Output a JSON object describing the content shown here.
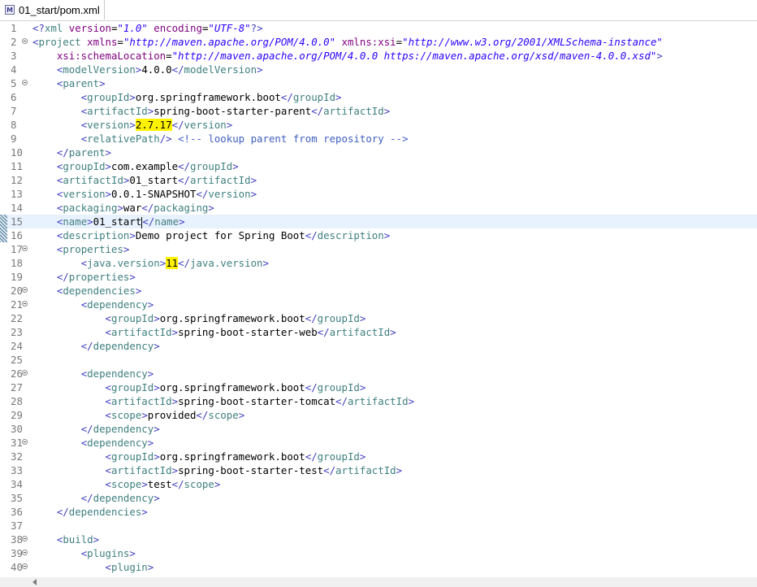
{
  "tab": {
    "label": "01_start/pom.xml",
    "icon": "maven-xml-file-icon"
  },
  "colors": {
    "tag": "#3f7f7f",
    "bracket": "#3f3fbf",
    "value": "#2a00ff",
    "attribute": "#7f007f",
    "comment": "#3f5fbf",
    "highlight": "#fff200",
    "current_line": "#e8f2fe"
  },
  "editor": {
    "current_line": 15,
    "lines": [
      {
        "n": "1",
        "segs": [
          [
            "b",
            "<?"
          ],
          [
            "t",
            "xml"
          ],
          [
            "x",
            " "
          ],
          [
            "a",
            "version"
          ],
          [
            "x",
            "="
          ],
          [
            "v",
            "\"1.0\""
          ],
          [
            "x",
            " "
          ],
          [
            "a",
            "encoding"
          ],
          [
            "x",
            "="
          ],
          [
            "v",
            "\"UTF-8\""
          ],
          [
            "b",
            "?>"
          ]
        ]
      },
      {
        "n": "2",
        "fold": true,
        "segs": [
          [
            "b",
            "<"
          ],
          [
            "t",
            "project"
          ],
          [
            "x",
            " "
          ],
          [
            "a",
            "xmlns"
          ],
          [
            "x",
            "="
          ],
          [
            "v",
            "\"http://maven.apache.org/POM/4.0.0\""
          ],
          [
            "x",
            " "
          ],
          [
            "a",
            "xmlns:xsi"
          ],
          [
            "x",
            "="
          ],
          [
            "v",
            "\"http://www.w3.org/2001/XMLSchema-instance\""
          ]
        ]
      },
      {
        "n": "3",
        "segs": [
          [
            "x",
            "    "
          ],
          [
            "a",
            "xsi:schemaLocation"
          ],
          [
            "x",
            "="
          ],
          [
            "v",
            "\"http://maven.apache.org/POM/4.0.0 https://maven.apache.org/xsd/maven-4.0.0.xsd\""
          ],
          [
            "b",
            ">"
          ]
        ]
      },
      {
        "n": "4",
        "segs": [
          [
            "x",
            "    "
          ],
          [
            "b",
            "<"
          ],
          [
            "t",
            "modelVersion"
          ],
          [
            "b",
            ">"
          ],
          [
            "x",
            "4.0.0"
          ],
          [
            "b",
            "</"
          ],
          [
            "t",
            "modelVersion"
          ],
          [
            "b",
            ">"
          ]
        ]
      },
      {
        "n": "5",
        "fold": true,
        "segs": [
          [
            "x",
            "    "
          ],
          [
            "b",
            "<"
          ],
          [
            "t",
            "parent"
          ],
          [
            "b",
            ">"
          ]
        ]
      },
      {
        "n": "6",
        "segs": [
          [
            "x",
            "        "
          ],
          [
            "b",
            "<"
          ],
          [
            "t",
            "groupId"
          ],
          [
            "b",
            ">"
          ],
          [
            "x",
            "org.springframework.boot"
          ],
          [
            "b",
            "</"
          ],
          [
            "t",
            "groupId"
          ],
          [
            "b",
            ">"
          ]
        ]
      },
      {
        "n": "7",
        "segs": [
          [
            "x",
            "        "
          ],
          [
            "b",
            "<"
          ],
          [
            "t",
            "artifactId"
          ],
          [
            "b",
            ">"
          ],
          [
            "x",
            "spring-boot-starter-parent"
          ],
          [
            "b",
            "</"
          ],
          [
            "t",
            "artifactId"
          ],
          [
            "b",
            ">"
          ]
        ]
      },
      {
        "n": "8",
        "segs": [
          [
            "x",
            "        "
          ],
          [
            "b",
            "<"
          ],
          [
            "t",
            "version"
          ],
          [
            "b",
            ">"
          ],
          [
            "hl",
            "2.7.17"
          ],
          [
            "b",
            "</"
          ],
          [
            "t",
            "version"
          ],
          [
            "b",
            ">"
          ]
        ]
      },
      {
        "n": "9",
        "segs": [
          [
            "x",
            "        "
          ],
          [
            "b",
            "<"
          ],
          [
            "t",
            "relativePath"
          ],
          [
            "b",
            "/>"
          ],
          [
            "x",
            " "
          ],
          [
            "c",
            "<!-- lookup parent from repository -->"
          ]
        ]
      },
      {
        "n": "10",
        "segs": [
          [
            "x",
            "    "
          ],
          [
            "b",
            "</"
          ],
          [
            "t",
            "parent"
          ],
          [
            "b",
            ">"
          ]
        ]
      },
      {
        "n": "11",
        "segs": [
          [
            "x",
            "    "
          ],
          [
            "b",
            "<"
          ],
          [
            "t",
            "groupId"
          ],
          [
            "b",
            ">"
          ],
          [
            "x",
            "com.example"
          ],
          [
            "b",
            "</"
          ],
          [
            "t",
            "groupId"
          ],
          [
            "b",
            ">"
          ]
        ]
      },
      {
        "n": "12",
        "segs": [
          [
            "x",
            "    "
          ],
          [
            "b",
            "<"
          ],
          [
            "t",
            "artifactId"
          ],
          [
            "b",
            ">"
          ],
          [
            "x",
            "01_start"
          ],
          [
            "b",
            "</"
          ],
          [
            "t",
            "artifactId"
          ],
          [
            "b",
            ">"
          ]
        ]
      },
      {
        "n": "13",
        "segs": [
          [
            "x",
            "    "
          ],
          [
            "b",
            "<"
          ],
          [
            "t",
            "version"
          ],
          [
            "b",
            ">"
          ],
          [
            "x",
            "0.0.1-SNAPSHOT"
          ],
          [
            "b",
            "</"
          ],
          [
            "t",
            "version"
          ],
          [
            "b",
            ">"
          ]
        ]
      },
      {
        "n": "14",
        "segs": [
          [
            "x",
            "    "
          ],
          [
            "b",
            "<"
          ],
          [
            "t",
            "packaging"
          ],
          [
            "b",
            ">"
          ],
          [
            "x",
            "war"
          ],
          [
            "b",
            "</"
          ],
          [
            "t",
            "packaging"
          ],
          [
            "b",
            ">"
          ]
        ]
      },
      {
        "n": "15",
        "marker": true,
        "segs": [
          [
            "x",
            "    "
          ],
          [
            "b",
            "<"
          ],
          [
            "t",
            "name"
          ],
          [
            "b",
            ">"
          ],
          [
            "x",
            "01_start"
          ],
          [
            "cur",
            ""
          ],
          [
            "b",
            "</"
          ],
          [
            "t",
            "name"
          ],
          [
            "b",
            ">"
          ]
        ]
      },
      {
        "n": "16",
        "marker": true,
        "segs": [
          [
            "x",
            "    "
          ],
          [
            "b",
            "<"
          ],
          [
            "t",
            "description"
          ],
          [
            "b",
            ">"
          ],
          [
            "x",
            "Demo project for Spring Boot"
          ],
          [
            "b",
            "</"
          ],
          [
            "t",
            "description"
          ],
          [
            "b",
            ">"
          ]
        ]
      },
      {
        "n": "17",
        "fold": true,
        "segs": [
          [
            "x",
            "    "
          ],
          [
            "b",
            "<"
          ],
          [
            "t",
            "properties"
          ],
          [
            "b",
            ">"
          ]
        ]
      },
      {
        "n": "18",
        "segs": [
          [
            "x",
            "        "
          ],
          [
            "b",
            "<"
          ],
          [
            "t",
            "java.version"
          ],
          [
            "b",
            ">"
          ],
          [
            "hl",
            "11"
          ],
          [
            "b",
            "</"
          ],
          [
            "t",
            "java.version"
          ],
          [
            "b",
            ">"
          ]
        ]
      },
      {
        "n": "19",
        "segs": [
          [
            "x",
            "    "
          ],
          [
            "b",
            "</"
          ],
          [
            "t",
            "properties"
          ],
          [
            "b",
            ">"
          ]
        ]
      },
      {
        "n": "20",
        "fold": true,
        "segs": [
          [
            "x",
            "    "
          ],
          [
            "b",
            "<"
          ],
          [
            "t",
            "dependencies"
          ],
          [
            "b",
            ">"
          ]
        ]
      },
      {
        "n": "21",
        "fold": true,
        "segs": [
          [
            "x",
            "        "
          ],
          [
            "b",
            "<"
          ],
          [
            "t",
            "dependency"
          ],
          [
            "b",
            ">"
          ]
        ]
      },
      {
        "n": "22",
        "segs": [
          [
            "x",
            "            "
          ],
          [
            "b",
            "<"
          ],
          [
            "t",
            "groupId"
          ],
          [
            "b",
            ">"
          ],
          [
            "x",
            "org.springframework.boot"
          ],
          [
            "b",
            "</"
          ],
          [
            "t",
            "groupId"
          ],
          [
            "b",
            ">"
          ]
        ]
      },
      {
        "n": "23",
        "segs": [
          [
            "x",
            "            "
          ],
          [
            "b",
            "<"
          ],
          [
            "t",
            "artifactId"
          ],
          [
            "b",
            ">"
          ],
          [
            "x",
            "spring-boot-starter-web"
          ],
          [
            "b",
            "</"
          ],
          [
            "t",
            "artifactId"
          ],
          [
            "b",
            ">"
          ]
        ]
      },
      {
        "n": "24",
        "segs": [
          [
            "x",
            "        "
          ],
          [
            "b",
            "</"
          ],
          [
            "t",
            "dependency"
          ],
          [
            "b",
            ">"
          ]
        ]
      },
      {
        "n": "25",
        "segs": []
      },
      {
        "n": "26",
        "fold": true,
        "segs": [
          [
            "x",
            "        "
          ],
          [
            "b",
            "<"
          ],
          [
            "t",
            "dependency"
          ],
          [
            "b",
            ">"
          ]
        ]
      },
      {
        "n": "27",
        "segs": [
          [
            "x",
            "            "
          ],
          [
            "b",
            "<"
          ],
          [
            "t",
            "groupId"
          ],
          [
            "b",
            ">"
          ],
          [
            "x",
            "org.springframework.boot"
          ],
          [
            "b",
            "</"
          ],
          [
            "t",
            "groupId"
          ],
          [
            "b",
            ">"
          ]
        ]
      },
      {
        "n": "28",
        "segs": [
          [
            "x",
            "            "
          ],
          [
            "b",
            "<"
          ],
          [
            "t",
            "artifactId"
          ],
          [
            "b",
            ">"
          ],
          [
            "x",
            "spring-boot-starter-tomcat"
          ],
          [
            "b",
            "</"
          ],
          [
            "t",
            "artifactId"
          ],
          [
            "b",
            ">"
          ]
        ]
      },
      {
        "n": "29",
        "segs": [
          [
            "x",
            "            "
          ],
          [
            "b",
            "<"
          ],
          [
            "t",
            "scope"
          ],
          [
            "b",
            ">"
          ],
          [
            "x",
            "provided"
          ],
          [
            "b",
            "</"
          ],
          [
            "t",
            "scope"
          ],
          [
            "b",
            ">"
          ]
        ]
      },
      {
        "n": "30",
        "segs": [
          [
            "x",
            "        "
          ],
          [
            "b",
            "</"
          ],
          [
            "t",
            "dependency"
          ],
          [
            "b",
            ">"
          ]
        ]
      },
      {
        "n": "31",
        "fold": true,
        "segs": [
          [
            "x",
            "        "
          ],
          [
            "b",
            "<"
          ],
          [
            "t",
            "dependency"
          ],
          [
            "b",
            ">"
          ]
        ]
      },
      {
        "n": "32",
        "segs": [
          [
            "x",
            "            "
          ],
          [
            "b",
            "<"
          ],
          [
            "t",
            "groupId"
          ],
          [
            "b",
            ">"
          ],
          [
            "x",
            "org.springframework.boot"
          ],
          [
            "b",
            "</"
          ],
          [
            "t",
            "groupId"
          ],
          [
            "b",
            ">"
          ]
        ]
      },
      {
        "n": "33",
        "segs": [
          [
            "x",
            "            "
          ],
          [
            "b",
            "<"
          ],
          [
            "t",
            "artifactId"
          ],
          [
            "b",
            ">"
          ],
          [
            "x",
            "spring-boot-starter-test"
          ],
          [
            "b",
            "</"
          ],
          [
            "t",
            "artifactId"
          ],
          [
            "b",
            ">"
          ]
        ]
      },
      {
        "n": "34",
        "segs": [
          [
            "x",
            "            "
          ],
          [
            "b",
            "<"
          ],
          [
            "t",
            "scope"
          ],
          [
            "b",
            ">"
          ],
          [
            "x",
            "test"
          ],
          [
            "b",
            "</"
          ],
          [
            "t",
            "scope"
          ],
          [
            "b",
            ">"
          ]
        ]
      },
      {
        "n": "35",
        "segs": [
          [
            "x",
            "        "
          ],
          [
            "b",
            "</"
          ],
          [
            "t",
            "dependency"
          ],
          [
            "b",
            ">"
          ]
        ]
      },
      {
        "n": "36",
        "segs": [
          [
            "x",
            "    "
          ],
          [
            "b",
            "</"
          ],
          [
            "t",
            "dependencies"
          ],
          [
            "b",
            ">"
          ]
        ]
      },
      {
        "n": "37",
        "segs": []
      },
      {
        "n": "38",
        "fold": true,
        "segs": [
          [
            "x",
            "    "
          ],
          [
            "b",
            "<"
          ],
          [
            "t",
            "build"
          ],
          [
            "b",
            ">"
          ]
        ]
      },
      {
        "n": "39",
        "fold": true,
        "segs": [
          [
            "x",
            "        "
          ],
          [
            "b",
            "<"
          ],
          [
            "t",
            "plugins"
          ],
          [
            "b",
            ">"
          ]
        ]
      },
      {
        "n": "40",
        "fold": true,
        "segs": [
          [
            "x",
            "            "
          ],
          [
            "b",
            "<"
          ],
          [
            "t",
            "plugin"
          ],
          [
            "b",
            ">"
          ]
        ]
      }
    ]
  }
}
